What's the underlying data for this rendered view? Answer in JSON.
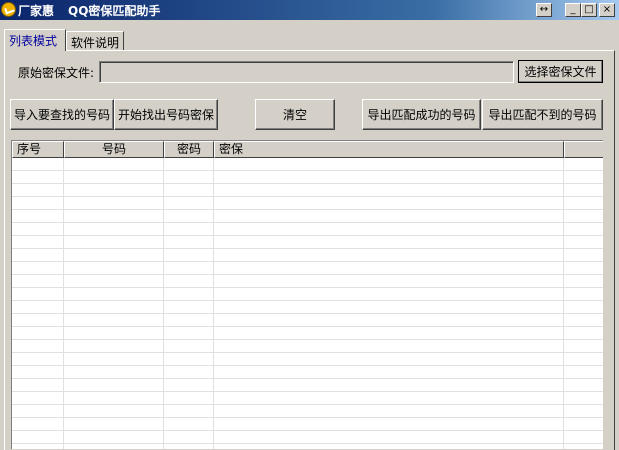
{
  "window": {
    "brand": "厂家惠",
    "title": "QQ密保匹配助手",
    "controls": {
      "resize": "↔",
      "minimize": "_",
      "maximize": "□",
      "close": "×"
    }
  },
  "tabs": [
    {
      "label": "列表模式",
      "active": true
    },
    {
      "label": "软件说明",
      "active": false
    }
  ],
  "file_row": {
    "label": "原始密保文件:",
    "value": "",
    "browse_button": "选择密保文件"
  },
  "actions": {
    "import": "导入要查找的号码",
    "start": "开始找出号码密保",
    "clear": "清空",
    "export_matched": "导出匹配成功的号码",
    "export_unmatched": "导出匹配不到的号码"
  },
  "table": {
    "columns": [
      "序号",
      "号码",
      "密码",
      "密保",
      ""
    ],
    "rows": []
  },
  "colors": {
    "title_gradient_start": "#0a246a",
    "title_gradient_end": "#a6caf0",
    "face": "#d4d0c8",
    "active_tab_text": "#0000a0"
  }
}
